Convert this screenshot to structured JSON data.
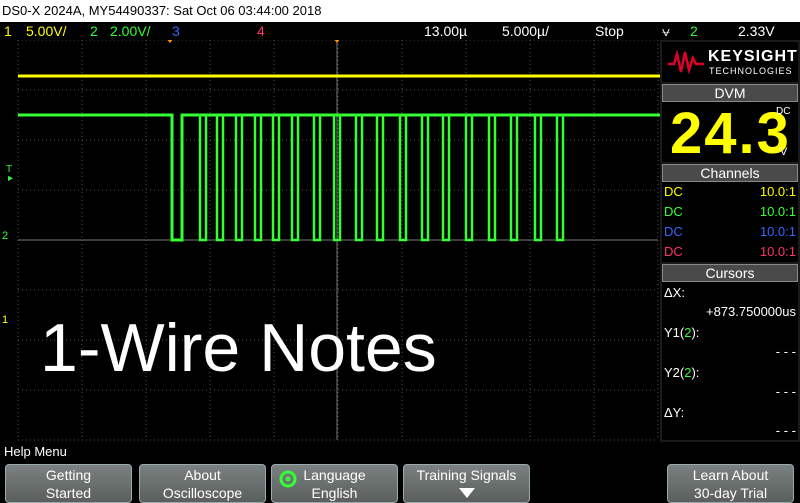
{
  "title_bar": "DS0-X 2024A, MY54490337: Sat Oct 06 03:44:00 2018",
  "channel_bar": {
    "ch1_num": "1",
    "ch1_scale": "5.00V/",
    "ch2_num": "2",
    "ch2_scale": "2.00V/",
    "ch3_num": "3",
    "ch4_num": "4",
    "delay": "13.00µ",
    "timebase": "5.000µ/",
    "run_state": "Stop",
    "trigger_icon": "⩝",
    "trigger_ch": "2",
    "trigger_level": "2.33V"
  },
  "screen": {
    "title_text": "1-Wire Notes",
    "marker_t": "T",
    "marker_1": "1",
    "marker_2": "2"
  },
  "logo": {
    "name": "KEYSIGHT",
    "sub": "TECHNOLOGIES"
  },
  "dvm": {
    "header": "DVM",
    "value": "24.3",
    "dc": "DC",
    "unit": "V"
  },
  "channels": {
    "header": "Channels",
    "rows": [
      {
        "coupling": "DC",
        "ratio": "10.0:1",
        "color": "#ffff00"
      },
      {
        "coupling": "DC",
        "ratio": "10.0:1",
        "color": "#33ff33"
      },
      {
        "coupling": "DC",
        "ratio": "10.0:1",
        "color": "#3366ff"
      },
      {
        "coupling": "DC",
        "ratio": "10.0:1",
        "color": "#ff3366"
      }
    ]
  },
  "cursors": {
    "header": "Cursors",
    "dx_label": "ΔX:",
    "dx_value": "+873.750000us",
    "y1_label": "Y1(",
    "y1_ch": "2",
    "y1_close": "):",
    "y1_value": "- - -",
    "y2_label": "Y2(",
    "y2_ch": "2",
    "y2_close": "):",
    "y2_value": "- - -",
    "dy_label": "ΔY:",
    "dy_value": "- - -"
  },
  "help_menu": "Help Menu",
  "softkeys": [
    {
      "line1": "Getting",
      "line2": "Started"
    },
    {
      "line1": "About",
      "line2": "Oscilloscope"
    },
    {
      "line1": "Language",
      "line2": "English"
    },
    {
      "line1": "Training Signals",
      "line2": ""
    },
    {
      "line1": "Learn About",
      "line2": "30-day Trial"
    }
  ],
  "colors": {
    "ch1": "#ffff00",
    "ch2": "#33ff33",
    "ch3": "#3366ff",
    "ch4": "#ff3366",
    "trigger": "#ff9900"
  }
}
